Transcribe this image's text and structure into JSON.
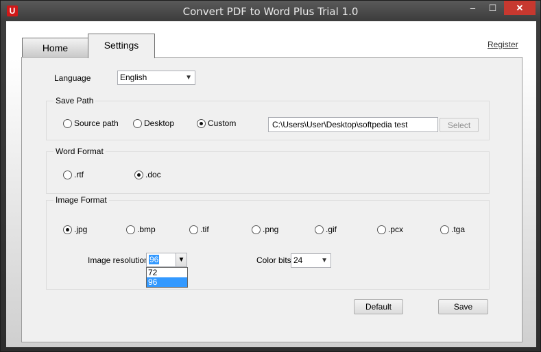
{
  "window": {
    "title": "Convert PDF to Word Plus Trial 1.0",
    "app_icon_glyph": "U",
    "minimize": "–",
    "maximize": "☐",
    "close": "✕"
  },
  "tabs": [
    {
      "label": "Home",
      "active": false
    },
    {
      "label": "Settings",
      "active": true
    }
  ],
  "register_link": "Register",
  "settings": {
    "language_label": "Language",
    "language_value": "English",
    "save_path": {
      "title": "Save Path",
      "options": [
        "Source path",
        "Desktop",
        "Custom"
      ],
      "selected": "Custom",
      "path_value": "C:\\Users\\User\\Desktop\\softpedia test",
      "select_button": "Select"
    },
    "word_format": {
      "title": "Word Format",
      "options": [
        ".rtf",
        ".doc"
      ],
      "selected": ".doc"
    },
    "image_format": {
      "title": "Image Format",
      "options": [
        ".jpg",
        ".bmp",
        ".tif",
        ".png",
        ".gif",
        ".pcx",
        ".tga"
      ],
      "selected": ".jpg",
      "resolution_label": "Image resolution",
      "resolution_value": "96",
      "resolution_options": [
        "72",
        "96"
      ],
      "resolution_highlighted": "96",
      "color_bits_label": "Color bits",
      "color_bits_value": "24"
    },
    "default_button": "Default",
    "save_button": "Save"
  },
  "colors": {
    "selection": "#3399ff",
    "close_button": "#c7382f",
    "app_icon": "#d01818"
  }
}
